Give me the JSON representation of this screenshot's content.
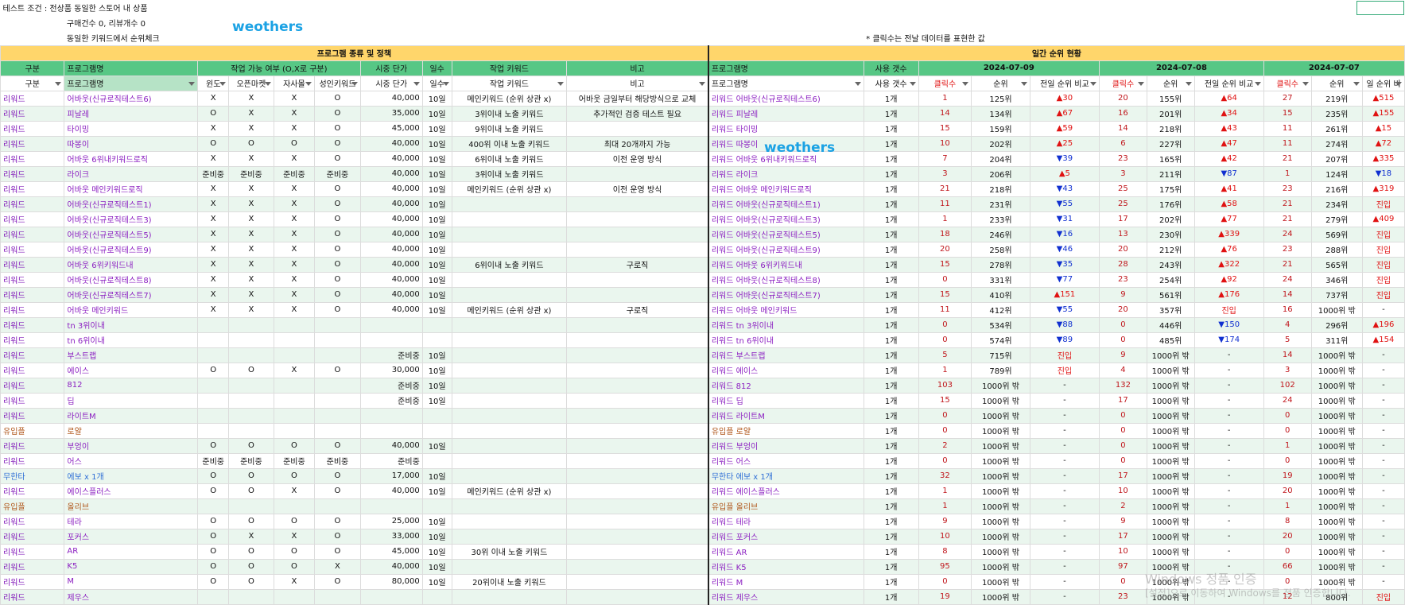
{
  "header": {
    "test_label": "테스트 조건 :",
    "cond1": "전상품 동일한 스토어 내 상품",
    "cond2": "구매건수 0, 리뷰개수 0",
    "cond3": "동일한 키워드에서 순위체크",
    "note": "* 클릭수는 전날 데이터를 표현한 값",
    "watermark": "weothers"
  },
  "section": {
    "left": "프로그램 종류 및 정책",
    "right": "일간 순위 현황"
  },
  "hdr2": {
    "category": "구분",
    "program": "프로그램명",
    "availability": "작업 가능 여부 (O,X로 구분)",
    "price": "시중 단가",
    "days": "일수",
    "keyword": "작업 키워드",
    "remark": "비고",
    "program_r": "프로그램명",
    "usage": "사용 갯수",
    "date1": "2024-07-09",
    "date2": "2024-07-08",
    "date3": "2024-07-07"
  },
  "hdr3": {
    "category": "구분",
    "program": "프로그램명",
    "window": "윈도",
    "openmarket": "오픈마켓",
    "own": "자사몰",
    "adult": "성인키워드",
    "price": "시중 단가",
    "days": "일수",
    "keyword": "작업 키워드",
    "remark": "비고",
    "program_r": "프로그램명",
    "usage": "사용 갯수",
    "clicks": "클릭수",
    "rank": "순위",
    "compare": "전일 순위 비교",
    "compare3": "일 순위 비"
  },
  "rows": [
    {
      "cat": "리워드",
      "name": "어바웃(신규로직테스트6)",
      "w": "X",
      "o": "X",
      "s": "X",
      "a": "O",
      "price": "40,000",
      "days": "10일",
      "kw": "메인키워드 (순위 상관 x)",
      "rm": "어바웃 금일부터 해당방식으로 교체",
      "rname": "리워드 어바웃(신규로직테스트6)",
      "use": "1개",
      "c1": "1",
      "r1": "125위",
      "d1": "▲30",
      "c2": "20",
      "r2": "155위",
      "d2": "▲64",
      "c3": "27",
      "r3": "219위",
      "d3": "▲515"
    },
    {
      "cat": "리워드",
      "name": "피날레",
      "w": "O",
      "o": "X",
      "s": "X",
      "a": "O",
      "price": "35,000",
      "days": "10일",
      "kw": "3위이내 노출 키워드",
      "rm": "추가적인 검증 테스트 필요",
      "rname": "리워드 피날레",
      "use": "1개",
      "c1": "14",
      "r1": "134위",
      "d1": "▲67",
      "c2": "16",
      "r2": "201위",
      "d2": "▲34",
      "c3": "15",
      "r3": "235위",
      "d3": "▲155"
    },
    {
      "cat": "리워드",
      "name": "타이밍",
      "w": "X",
      "o": "X",
      "s": "X",
      "a": "O",
      "price": "45,000",
      "days": "10일",
      "kw": "9위이내 노출 키워드",
      "rm": "",
      "rname": "리워드 타이밍",
      "use": "1개",
      "c1": "15",
      "r1": "159위",
      "d1": "▲59",
      "c2": "14",
      "r2": "218위",
      "d2": "▲43",
      "c3": "11",
      "r3": "261위",
      "d3": "▲15"
    },
    {
      "cat": "리워드",
      "name": "따봉이",
      "w": "O",
      "o": "O",
      "s": "O",
      "a": "O",
      "price": "40,000",
      "days": "10일",
      "kw": "400위 이내 노출 키워드",
      "rm": "최대 20개까지 가능",
      "rname": "리워드 따봉이",
      "use": "1개",
      "c1": "10",
      "r1": "202위",
      "d1": "▲25",
      "c2": "6",
      "r2": "227위",
      "d2": "▲47",
      "c3": "11",
      "r3": "274위",
      "d3": "▲72"
    },
    {
      "cat": "리워드",
      "name": "어바웃 6위내키워드로직",
      "w": "X",
      "o": "X",
      "s": "X",
      "a": "O",
      "price": "40,000",
      "days": "10일",
      "kw": "6위이내 노출 키워드",
      "rm": "이전 운영 방식",
      "rname": "리워드 어바웃 6위내키워드로직",
      "use": "1개",
      "c1": "7",
      "r1": "204위",
      "d1": "▼39",
      "c2": "23",
      "r2": "165위",
      "d2": "▲42",
      "c3": "21",
      "r3": "207위",
      "d3": "▲335"
    },
    {
      "cat": "리워드",
      "name": "라이크",
      "w": "준비중",
      "o": "준비중",
      "s": "준비중",
      "a": "준비중",
      "price": "40,000",
      "days": "10일",
      "kw": "3위이내 노출 키워드",
      "rm": "",
      "rname": "리워드 라이크",
      "use": "1개",
      "c1": "3",
      "r1": "206위",
      "d1": "▲5",
      "c2": "3",
      "r2": "211위",
      "d2": "▼87",
      "c3": "1",
      "r3": "124위",
      "d3": "▼18"
    },
    {
      "cat": "리워드",
      "name": "어바웃 메인키워드로직",
      "w": "X",
      "o": "X",
      "s": "X",
      "a": "O",
      "price": "40,000",
      "days": "10일",
      "kw": "메인키워드 (순위 상관 x)",
      "rm": "이전 운영 방식",
      "rname": "리워드 어바웃 메인키워드로직",
      "use": "1개",
      "c1": "21",
      "r1": "218위",
      "d1": "▼43",
      "c2": "25",
      "r2": "175위",
      "d2": "▲41",
      "c3": "23",
      "r3": "216위",
      "d3": "▲319"
    },
    {
      "cat": "리워드",
      "name": "어바웃(신규로직테스트1)",
      "w": "X",
      "o": "X",
      "s": "X",
      "a": "O",
      "price": "40,000",
      "days": "10일",
      "kw": "",
      "rm": "",
      "rname": "리워드 어바웃(신규로직테스트1)",
      "use": "1개",
      "c1": "11",
      "r1": "231위",
      "d1": "▼55",
      "c2": "25",
      "r2": "176위",
      "d2": "▲58",
      "c3": "21",
      "r3": "234위",
      "d3": "진입"
    },
    {
      "cat": "리워드",
      "name": "어바웃(신규로직테스트3)",
      "w": "X",
      "o": "X",
      "s": "X",
      "a": "O",
      "price": "40,000",
      "days": "10일",
      "kw": "",
      "rm": "",
      "rname": "리워드 어바웃(신규로직테스트3)",
      "use": "1개",
      "c1": "1",
      "r1": "233위",
      "d1": "▼31",
      "c2": "17",
      "r2": "202위",
      "d2": "▲77",
      "c3": "21",
      "r3": "279위",
      "d3": "▲409"
    },
    {
      "cat": "리워드",
      "name": "어바웃(신규로직테스트5)",
      "w": "X",
      "o": "X",
      "s": "X",
      "a": "O",
      "price": "40,000",
      "days": "10일",
      "kw": "",
      "rm": "",
      "rname": "리워드 어바웃(신규로직테스트5)",
      "use": "1개",
      "c1": "18",
      "r1": "246위",
      "d1": "▼16",
      "c2": "13",
      "r2": "230위",
      "d2": "▲339",
      "c3": "24",
      "r3": "569위",
      "d3": "진입"
    },
    {
      "cat": "리워드",
      "name": "어바웃(신규로직테스트9)",
      "w": "X",
      "o": "X",
      "s": "X",
      "a": "O",
      "price": "40,000",
      "days": "10일",
      "kw": "",
      "rm": "",
      "rname": "리워드 어바웃(신규로직테스트9)",
      "use": "1개",
      "c1": "20",
      "r1": "258위",
      "d1": "▼46",
      "c2": "20",
      "r2": "212위",
      "d2": "▲76",
      "c3": "23",
      "r3": "288위",
      "d3": "진입"
    },
    {
      "cat": "리워드",
      "name": "어바웃 6위키워드내",
      "w": "X",
      "o": "X",
      "s": "X",
      "a": "O",
      "price": "40,000",
      "days": "10일",
      "kw": "6위이내 노출 키워드",
      "rm": "구로직",
      "rname": "리워드 어바웃 6위키워드내",
      "use": "1개",
      "c1": "15",
      "r1": "278위",
      "d1": "▼35",
      "c2": "28",
      "r2": "243위",
      "d2": "▲322",
      "c3": "21",
      "r3": "565위",
      "d3": "진입"
    },
    {
      "cat": "리워드",
      "name": "어바웃(신규로직테스트8)",
      "w": "X",
      "o": "X",
      "s": "X",
      "a": "O",
      "price": "40,000",
      "days": "10일",
      "kw": "",
      "rm": "",
      "rname": "리워드 어바웃(신규로직테스트8)",
      "use": "1개",
      "c1": "0",
      "r1": "331위",
      "d1": "▼77",
      "c2": "23",
      "r2": "254위",
      "d2": "▲92",
      "c3": "24",
      "r3": "346위",
      "d3": "진입"
    },
    {
      "cat": "리워드",
      "name": "어바웃(신규로직테스트7)",
      "w": "X",
      "o": "X",
      "s": "X",
      "a": "O",
      "price": "40,000",
      "days": "10일",
      "kw": "",
      "rm": "",
      "rname": "리워드 어바웃(신규로직테스트7)",
      "use": "1개",
      "c1": "15",
      "r1": "410위",
      "d1": "▲151",
      "c2": "9",
      "r2": "561위",
      "d2": "▲176",
      "c3": "14",
      "r3": "737위",
      "d3": "진입"
    },
    {
      "cat": "리워드",
      "name": "어바웃 메인키워드",
      "w": "X",
      "o": "X",
      "s": "X",
      "a": "O",
      "price": "40,000",
      "days": "10일",
      "kw": "메인키워드 (순위 상관 x)",
      "rm": "구로직",
      "rname": "리워드 어바웃 메인키워드",
      "use": "1개",
      "c1": "11",
      "r1": "412위",
      "d1": "▼55",
      "c2": "20",
      "r2": "357위",
      "d2": "진입",
      "c3": "16",
      "r3": "1000위 밖",
      "d3": "-"
    },
    {
      "cat": "리워드",
      "name": "tn 3위이내",
      "w": "",
      "o": "",
      "s": "",
      "a": "",
      "price": "",
      "days": "",
      "kw": "",
      "rm": "",
      "rname": "리워드 tn 3위이내",
      "use": "1개",
      "c1": "0",
      "r1": "534위",
      "d1": "▼88",
      "c2": "0",
      "r2": "446위",
      "d2": "▼150",
      "c3": "4",
      "r3": "296위",
      "d3": "▲196"
    },
    {
      "cat": "리워드",
      "name": "tn 6위이내",
      "w": "",
      "o": "",
      "s": "",
      "a": "",
      "price": "",
      "days": "",
      "kw": "",
      "rm": "",
      "rname": "리워드 tn 6위이내",
      "use": "1개",
      "c1": "0",
      "r1": "574위",
      "d1": "▼89",
      "c2": "0",
      "r2": "485위",
      "d2": "▼174",
      "c3": "5",
      "r3": "311위",
      "d3": "▲154"
    },
    {
      "cat": "리워드",
      "name": "부스트랩",
      "w": "",
      "o": "",
      "s": "",
      "a": "",
      "price": "준비중",
      "days": "10일",
      "kw": "",
      "rm": "",
      "rname": "리워드 부스트랩",
      "use": "1개",
      "c1": "5",
      "r1": "715위",
      "d1": "진입",
      "c2": "9",
      "r2": "1000위 밖",
      "d2": "-",
      "c3": "14",
      "r3": "1000위 밖",
      "d3": "-"
    },
    {
      "cat": "리워드",
      "name": "에이스",
      "w": "O",
      "o": "O",
      "s": "X",
      "a": "O",
      "price": "30,000",
      "days": "10일",
      "kw": "",
      "rm": "",
      "rname": "리워드 에이스",
      "use": "1개",
      "c1": "1",
      "r1": "789위",
      "d1": "진입",
      "c2": "4",
      "r2": "1000위 밖",
      "d2": "-",
      "c3": "3",
      "r3": "1000위 밖",
      "d3": "-"
    },
    {
      "cat": "리워드",
      "name": "812",
      "w": "",
      "o": "",
      "s": "",
      "a": "",
      "price": "준비중",
      "days": "10일",
      "kw": "",
      "rm": "",
      "rname": "리워드 812",
      "use": "1개",
      "c1": "103",
      "r1": "1000위 밖",
      "d1": "-",
      "c2": "132",
      "r2": "1000위 밖",
      "d2": "-",
      "c3": "102",
      "r3": "1000위 밖",
      "d3": "-"
    },
    {
      "cat": "리워드",
      "name": "딥",
      "w": "",
      "o": "",
      "s": "",
      "a": "",
      "price": "준비중",
      "days": "10일",
      "kw": "",
      "rm": "",
      "rname": "리워드 딥",
      "use": "1개",
      "c1": "15",
      "r1": "1000위 밖",
      "d1": "-",
      "c2": "17",
      "r2": "1000위 밖",
      "d2": "-",
      "c3": "24",
      "r3": "1000위 밖",
      "d3": "-"
    },
    {
      "cat": "리워드",
      "name": "라이트M",
      "w": "",
      "o": "",
      "s": "",
      "a": "",
      "price": "",
      "days": "",
      "kw": "",
      "rm": "",
      "rname": "리워드 라이트M",
      "use": "1개",
      "c1": "0",
      "r1": "1000위 밖",
      "d1": "-",
      "c2": "0",
      "r2": "1000위 밖",
      "d2": "-",
      "c3": "0",
      "r3": "1000위 밖",
      "d3": "-"
    },
    {
      "cat": "유입플",
      "name": "로얄",
      "w": "",
      "o": "",
      "s": "",
      "a": "",
      "price": "",
      "days": "",
      "kw": "",
      "rm": "",
      "rname": "유입플 로얄",
      "use": "1개",
      "c1": "0",
      "r1": "1000위 밖",
      "d1": "-",
      "c2": "0",
      "r2": "1000위 밖",
      "d2": "-",
      "c3": "0",
      "r3": "1000위 밖",
      "d3": "-"
    },
    {
      "cat": "리워드",
      "name": "부엉이",
      "w": "O",
      "o": "O",
      "s": "O",
      "a": "O",
      "price": "40,000",
      "days": "10일",
      "kw": "",
      "rm": "",
      "rname": "리워드 부엉이",
      "use": "1개",
      "c1": "2",
      "r1": "1000위 밖",
      "d1": "-",
      "c2": "0",
      "r2": "1000위 밖",
      "d2": "-",
      "c3": "1",
      "r3": "1000위 밖",
      "d3": "-"
    },
    {
      "cat": "리워드",
      "name": "어스",
      "w": "준비중",
      "o": "준비중",
      "s": "준비중",
      "a": "준비중",
      "price": "준비중",
      "days": "",
      "kw": "",
      "rm": "",
      "rname": "리워드 어스",
      "use": "1개",
      "c1": "0",
      "r1": "1000위 밖",
      "d1": "-",
      "c2": "0",
      "r2": "1000위 밖",
      "d2": "-",
      "c3": "0",
      "r3": "1000위 밖",
      "d3": "-"
    },
    {
      "cat": "무한타",
      "name": "에보 x 1개",
      "w": "O",
      "o": "O",
      "s": "O",
      "a": "O",
      "price": "17,000",
      "days": "10일",
      "kw": "",
      "rm": "",
      "rname": "무한타 에보 x 1개",
      "use": "1개",
      "c1": "32",
      "r1": "1000위 밖",
      "d1": "-",
      "c2": "17",
      "r2": "1000위 밖",
      "d2": "-",
      "c3": "19",
      "r3": "1000위 밖",
      "d3": "-"
    },
    {
      "cat": "리워드",
      "name": "에이스플러스",
      "w": "O",
      "o": "O",
      "s": "X",
      "a": "O",
      "price": "40,000",
      "days": "10일",
      "kw": "메인키워드 (순위 상관 x)",
      "rm": "",
      "rname": "리워드 에이스플러스",
      "use": "1개",
      "c1": "1",
      "r1": "1000위 밖",
      "d1": "-",
      "c2": "10",
      "r2": "1000위 밖",
      "d2": "-",
      "c3": "20",
      "r3": "1000위 밖",
      "d3": "-"
    },
    {
      "cat": "유입플",
      "name": "올리브",
      "w": "",
      "o": "",
      "s": "",
      "a": "",
      "price": "",
      "days": "",
      "kw": "",
      "rm": "",
      "rname": "유입플 올리브",
      "use": "1개",
      "c1": "1",
      "r1": "1000위 밖",
      "d1": "-",
      "c2": "2",
      "r2": "1000위 밖",
      "d2": "-",
      "c3": "1",
      "r3": "1000위 밖",
      "d3": "-"
    },
    {
      "cat": "리워드",
      "name": "테라",
      "w": "O",
      "o": "O",
      "s": "O",
      "a": "O",
      "price": "25,000",
      "days": "10일",
      "kw": "",
      "rm": "",
      "rname": "리워드 테라",
      "use": "1개",
      "c1": "9",
      "r1": "1000위 밖",
      "d1": "-",
      "c2": "9",
      "r2": "1000위 밖",
      "d2": "-",
      "c3": "8",
      "r3": "1000위 밖",
      "d3": "-"
    },
    {
      "cat": "리워드",
      "name": "포커스",
      "w": "O",
      "o": "X",
      "s": "X",
      "a": "O",
      "price": "33,000",
      "days": "10일",
      "kw": "",
      "rm": "",
      "rname": "리워드 포커스",
      "use": "1개",
      "c1": "10",
      "r1": "1000위 밖",
      "d1": "-",
      "c2": "17",
      "r2": "1000위 밖",
      "d2": "-",
      "c3": "20",
      "r3": "1000위 밖",
      "d3": "-"
    },
    {
      "cat": "리워드",
      "name": "AR",
      "w": "O",
      "o": "O",
      "s": "O",
      "a": "O",
      "price": "45,000",
      "days": "10일",
      "kw": "30위 이내 노출 키워드",
      "rm": "",
      "rname": "리워드 AR",
      "use": "1개",
      "c1": "8",
      "r1": "1000위 밖",
      "d1": "-",
      "c2": "10",
      "r2": "1000위 밖",
      "d2": "-",
      "c3": "0",
      "r3": "1000위 밖",
      "d3": "-"
    },
    {
      "cat": "리워드",
      "name": "K5",
      "w": "O",
      "o": "O",
      "s": "O",
      "a": "X",
      "price": "40,000",
      "days": "10일",
      "kw": "",
      "rm": "",
      "rname": "리워드 K5",
      "use": "1개",
      "c1": "95",
      "r1": "1000위 밖",
      "d1": "-",
      "c2": "97",
      "r2": "1000위 밖",
      "d2": "-",
      "c3": "66",
      "r3": "1000위 밖",
      "d3": "-"
    },
    {
      "cat": "리워드",
      "name": "M",
      "w": "O",
      "o": "O",
      "s": "X",
      "a": "O",
      "price": "80,000",
      "days": "10일",
      "kw": "20위이내 노출 키워드",
      "rm": "",
      "rname": "리워드 M",
      "use": "1개",
      "c1": "0",
      "r1": "1000위 밖",
      "d1": "-",
      "c2": "0",
      "r2": "1000위 밖",
      "d2": "-",
      "c3": "0",
      "r3": "1000위 밖",
      "d3": "-"
    },
    {
      "cat": "리워드",
      "name": "제우스",
      "w": "",
      "o": "",
      "s": "",
      "a": "",
      "price": "",
      "days": "",
      "kw": "",
      "rm": "",
      "rname": "리워드 제우스",
      "use": "1개",
      "c1": "19",
      "r1": "1000위 밖",
      "d1": "-",
      "c2": "23",
      "r2": "1000위 밖",
      "d2": "-",
      "c3": "12",
      "r3": "800위",
      "d3": "진입"
    }
  ],
  "windows_watermark": {
    "line1": "Windows 정품 인증",
    "line2": "[설정]으로 이동하여 Windows를 정품 인증합니다."
  }
}
